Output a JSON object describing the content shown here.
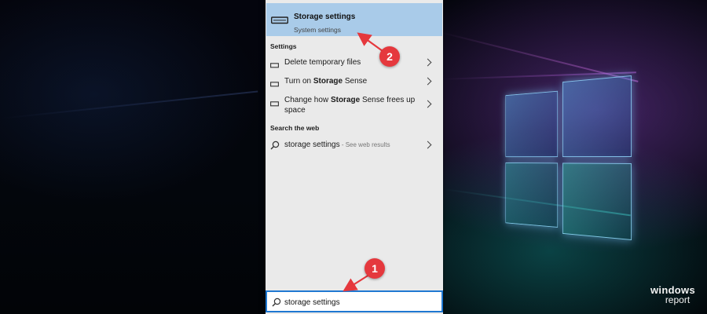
{
  "colors": {
    "accent": "#1f78d1",
    "top_result_bg": "#a9cbe9",
    "panel_bg": "#eaeaea",
    "annotation": "#e5383d"
  },
  "top_result": {
    "title": "Storage settings",
    "subtitle": "System settings",
    "icon": "drive-icon"
  },
  "settings_section": {
    "header": "Settings",
    "items": [
      {
        "icon": "drive-icon",
        "parts": [
          {
            "text": "Delete temporary files",
            "bold": false
          }
        ]
      },
      {
        "icon": "drive-icon",
        "parts": [
          {
            "text": "Turn on ",
            "bold": false
          },
          {
            "text": "Storage",
            "bold": true
          },
          {
            "text": " Sense",
            "bold": false
          }
        ]
      },
      {
        "icon": "drive-icon",
        "parts": [
          {
            "text": "Change how ",
            "bold": false
          },
          {
            "text": "Storage",
            "bold": true
          },
          {
            "text": " Sense frees up",
            "bold": false
          }
        ],
        "line2": "space"
      }
    ]
  },
  "web_section": {
    "header": "Search the web",
    "query": "storage settings",
    "hint": " - See web results",
    "icon": "search-icon"
  },
  "search_box": {
    "value": "storage settings",
    "icon": "search-icon"
  },
  "annotations": [
    "1",
    "2"
  ],
  "watermark": {
    "line1": "windows",
    "line2": "report"
  }
}
